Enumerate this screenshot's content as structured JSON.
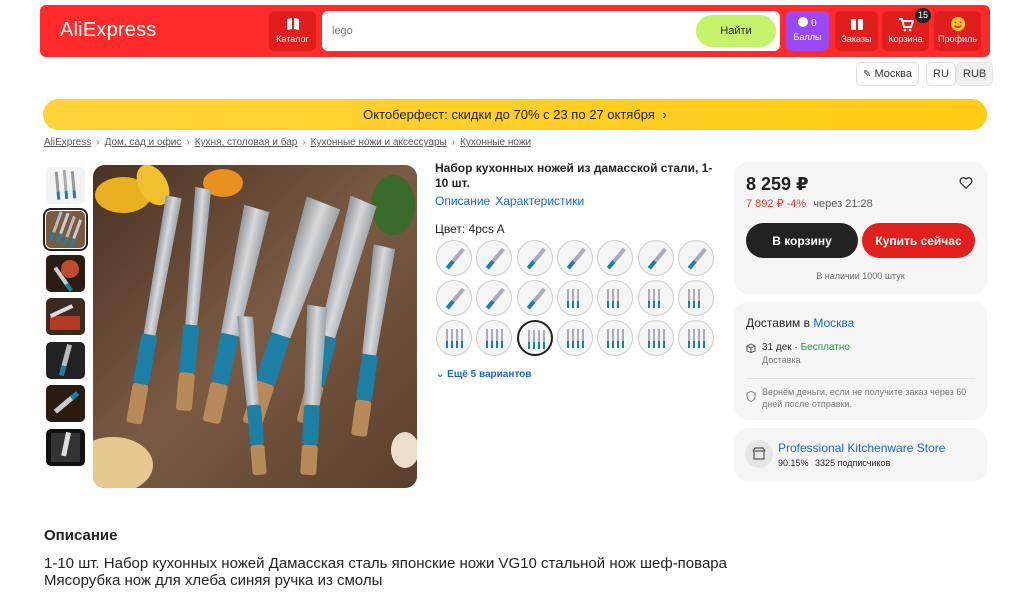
{
  "header": {
    "logo": "AliExpress",
    "catalog_label": "Каталог",
    "search_value": "lego",
    "search_button": "Найти",
    "points_count": "0",
    "points_label": "Баллы",
    "orders_label": "Заказы",
    "cart_label": "Корзина",
    "cart_count": "15",
    "profile_label": "Профиль"
  },
  "region": {
    "city": "Москва",
    "lang": "RU",
    "currency": "RUB"
  },
  "promo": "Октоберфест: скидки до 70% с 23 по 27 октября",
  "breadcrumbs": [
    "AliExpress",
    "Дом, сад и офис",
    "Кухня, столовая и бар",
    "Кухонные ножи и аксессуары",
    "Кухонные ножи"
  ],
  "product": {
    "title": "Набор кухонных ножей из дамасской стали, 1-10 шт.",
    "tabs": [
      "Описание",
      "Характеристики"
    ],
    "color_label": "Цвет: 4pcs A",
    "more_variants": "Ещё 5 вариантов"
  },
  "price_card": {
    "price": "8 259 ₽",
    "old_price": "7 892 ₽",
    "discount": "-4%",
    "timer": "через 21:28",
    "cart_button": "В корзину",
    "buy_button": "Купить сейчас",
    "stock": "В наличии 1000 штук"
  },
  "delivery": {
    "title": "Доставим в",
    "city": "Москва",
    "date": "31 дек",
    "sep": " · ",
    "free": "Бесплатно",
    "date_sub": "Доставка",
    "refund": "Вернём деньги, если не получите заказ через 60 дней после отправки."
  },
  "store": {
    "name": "Professional Kitchenware Store",
    "rating": "90.15%",
    "followers": "3325 подписчиков"
  },
  "description": {
    "heading": "Описание",
    "text": "1-10 шт. Набор кухонных ножей Дамасская сталь японские ножи VG10 стальной нож шеф-повара Мясорубка нож для хлеба синяя ручка из смолы"
  },
  "colors": {
    "brand_red": "#ff2a2a",
    "promo_yellow": "#ffd33a",
    "buy_red": "#e0201c",
    "link_blue": "#1a66c7",
    "handle_blue": "#1b7fa6"
  }
}
